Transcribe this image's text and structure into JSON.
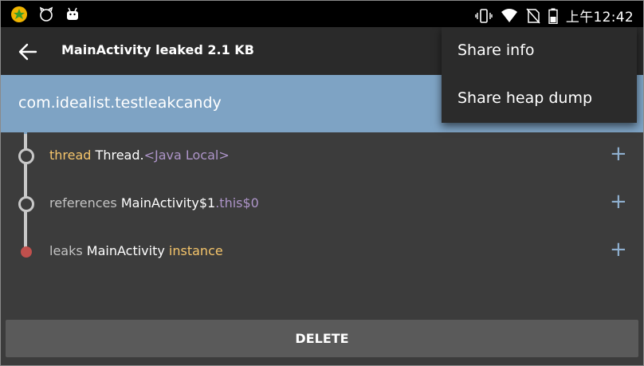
{
  "status_bar": {
    "time": "上午12:42",
    "left_icons": [
      "app-icon",
      "cat-icon",
      "android-icon"
    ],
    "right_icons": [
      "vibrate-icon",
      "wifi-icon",
      "no-sim-icon",
      "battery-icon"
    ]
  },
  "app_bar": {
    "title": "MainActivity leaked 2.1 KB",
    "back_icon": "back-arrow-icon"
  },
  "header": {
    "package": "com.idealist.testleakcandy",
    "band_color": "#7ea3c4"
  },
  "leak_trace": [
    {
      "prefix": "thread",
      "name": "Thread.",
      "suffix": "<Java Local>"
    },
    {
      "prefix": "references",
      "name": "MainActivity$1",
      "suffix": ".this$0"
    },
    {
      "prefix": "leaks",
      "name": "MainActivity",
      "suffix": "instance"
    }
  ],
  "expand_label": "+",
  "delete_button": "DELETE",
  "overflow_menu": {
    "items": [
      "Share info",
      "Share heap dump"
    ]
  },
  "colors": {
    "accent": "#8fb0d0",
    "leak_node": "#c0504d",
    "highlight_yellow": "#f5c56b",
    "highlight_purple": "#ad94c8"
  }
}
